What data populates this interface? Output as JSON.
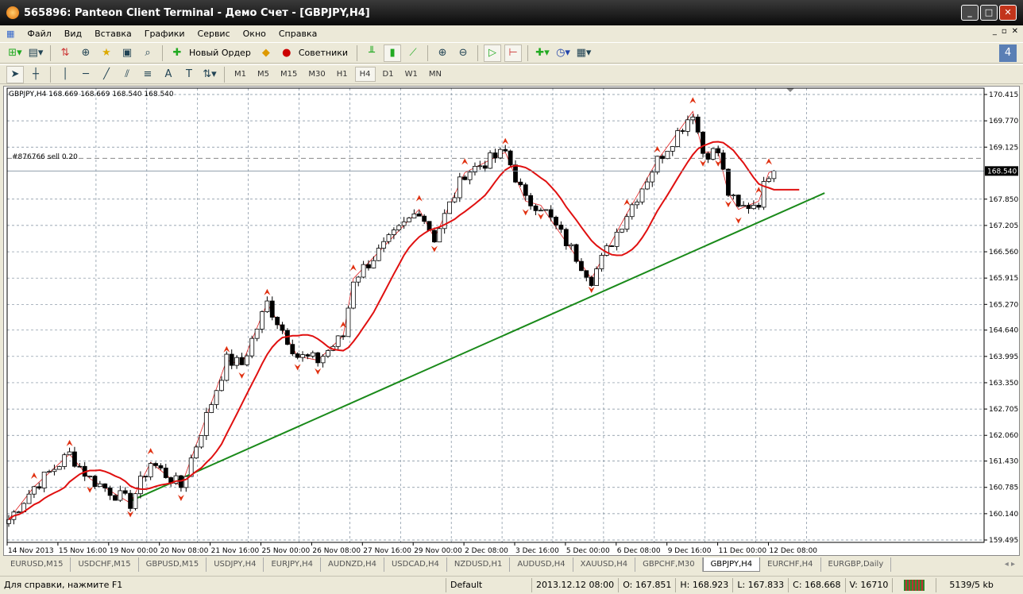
{
  "window": {
    "title": "565896: Panteon Client Terminal - Демо Счет - [GBPJPY,H4]"
  },
  "menu": [
    "Файл",
    "Вид",
    "Вставка",
    "Графики",
    "Сервис",
    "Окно",
    "Справка"
  ],
  "toolbar": {
    "new_order": "Новый Ордер",
    "experts": "Советники"
  },
  "timeframes": [
    "M1",
    "M5",
    "M15",
    "M30",
    "H1",
    "H4",
    "D1",
    "W1",
    "MN"
  ],
  "active_timeframe": "H4",
  "chart": {
    "header": "GBPJPY,H4  168.669 168.669 168.540 168.540",
    "order_label": "#876766 sell 0.20",
    "current_price": "168.540",
    "price_ticks": [
      "170.415",
      "169.770",
      "169.125",
      "167.850",
      "167.205",
      "166.560",
      "165.915",
      "165.270",
      "164.640",
      "163.995",
      "163.350",
      "162.705",
      "162.060",
      "161.430",
      "160.785",
      "160.140",
      "159.495"
    ],
    "time_ticks": [
      "14 Nov 2013",
      "15 Nov 16:00",
      "19 Nov 00:00",
      "20 Nov 08:00",
      "21 Nov 16:00",
      "25 Nov 00:00",
      "26 Nov 08:00",
      "27 Nov 16:00",
      "29 Nov 00:00",
      "2 Dec 08:00",
      "3 Dec 16:00",
      "5 Dec 00:00",
      "6 Dec 08:00",
      "9 Dec 16:00",
      "11 Dec 00:00",
      "12 Dec 08:00"
    ]
  },
  "chart_data": {
    "type": "candlestick",
    "symbol": "GBPJPY",
    "timeframe": "H4",
    "ylim": [
      159.495,
      170.415
    ],
    "order_price": 168.85,
    "close_path_bar_index": [
      0,
      5,
      12,
      16,
      24,
      28,
      34,
      43,
      46,
      51,
      57,
      61,
      66,
      68,
      81,
      84,
      90,
      98,
      102,
      105,
      115,
      122,
      128,
      135,
      137,
      140,
      142,
      144,
      148,
      150,
      151
    ],
    "close_path_price": [
      160.0,
      160.8,
      161.6,
      161.0,
      160.4,
      161.4,
      160.8,
      163.9,
      163.8,
      165.3,
      164.0,
      163.9,
      164.5,
      165.9,
      167.6,
      166.9,
      168.5,
      169.0,
      167.8,
      167.7,
      165.9,
      167.5,
      168.8,
      170.0,
      169.0,
      169.0,
      168.0,
      167.6,
      167.8,
      168.5,
      168.54
    ],
    "trendline": {
      "from": [
        24,
        160.45
      ],
      "to": [
        161,
        168.0
      ]
    },
    "ma_period": 12
  },
  "tabs": [
    "EURUSD,M15",
    "USDCHF,M15",
    "GBPUSD,M15",
    "USDJPY,H4",
    "EURJPY,H4",
    "AUDNZD,H4",
    "USDCAD,H4",
    "NZDUSD,H1",
    "AUDUSD,H4",
    "XAUUSD,H4",
    "GBPCHF,M30",
    "GBPJPY,H4",
    "EURCHF,H4",
    "EURGBP,Daily"
  ],
  "active_tab": "GBPJPY,H4",
  "status": {
    "help": "Для справки, нажмите F1",
    "profile": "Default",
    "time": "2013.12.12 08:00",
    "open": "O: 167.851",
    "high": "H: 168.923",
    "low": "L: 167.833",
    "close": "C: 168.668",
    "volume": "V: 16710",
    "traffic": "5139/5 kb"
  }
}
